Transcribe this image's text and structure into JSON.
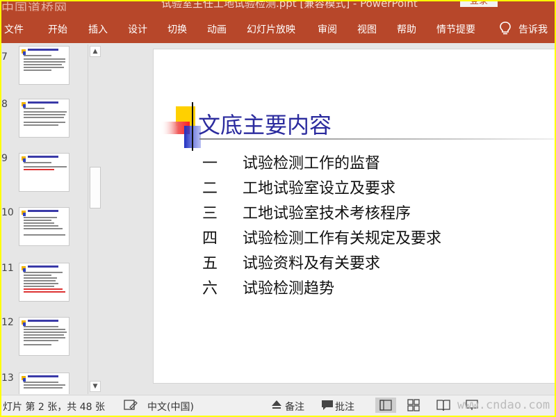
{
  "window": {
    "title": "试验室主任工地试验检测.ppt [兼容模式] - PowerPoint",
    "login_label": "登录",
    "watermark_top": "中国道桥网"
  },
  "ribbon": {
    "tabs": [
      "文件",
      "开始",
      "插入",
      "设计",
      "切换",
      "动画",
      "幻灯片放映",
      "审阅",
      "视图",
      "帮助",
      "情节提要"
    ],
    "tell_me": "告诉我",
    "tell_me_icon": "lightbulb-icon"
  },
  "thumbnails": {
    "slide_numbers": [
      "7",
      "8",
      "9",
      "10",
      "11",
      "12",
      "13"
    ]
  },
  "slide": {
    "title": "文底主要内容",
    "items": [
      {
        "num": "一",
        "text": "试验检测工作的监督"
      },
      {
        "num": "二",
        "text": "工地试验室设立及要求"
      },
      {
        "num": "三",
        "text": "工地试验室技术考核程序"
      },
      {
        "num": "四",
        "text": "试验检测工作有关规定及要求"
      },
      {
        "num": "五",
        "text": "试验资料及有关要求"
      },
      {
        "num": "六",
        "text": "试验检测趋势"
      }
    ]
  },
  "statusbar": {
    "slide_info": "灯片 第 2 张，共 48 张",
    "language": "中文(中国)",
    "notes": "备注",
    "comments": "批注",
    "watermark": "www.cndao.com"
  },
  "colors": {
    "accent": "#b7472a",
    "title_blue": "#2b2b9e",
    "frame": "#ffff00"
  }
}
